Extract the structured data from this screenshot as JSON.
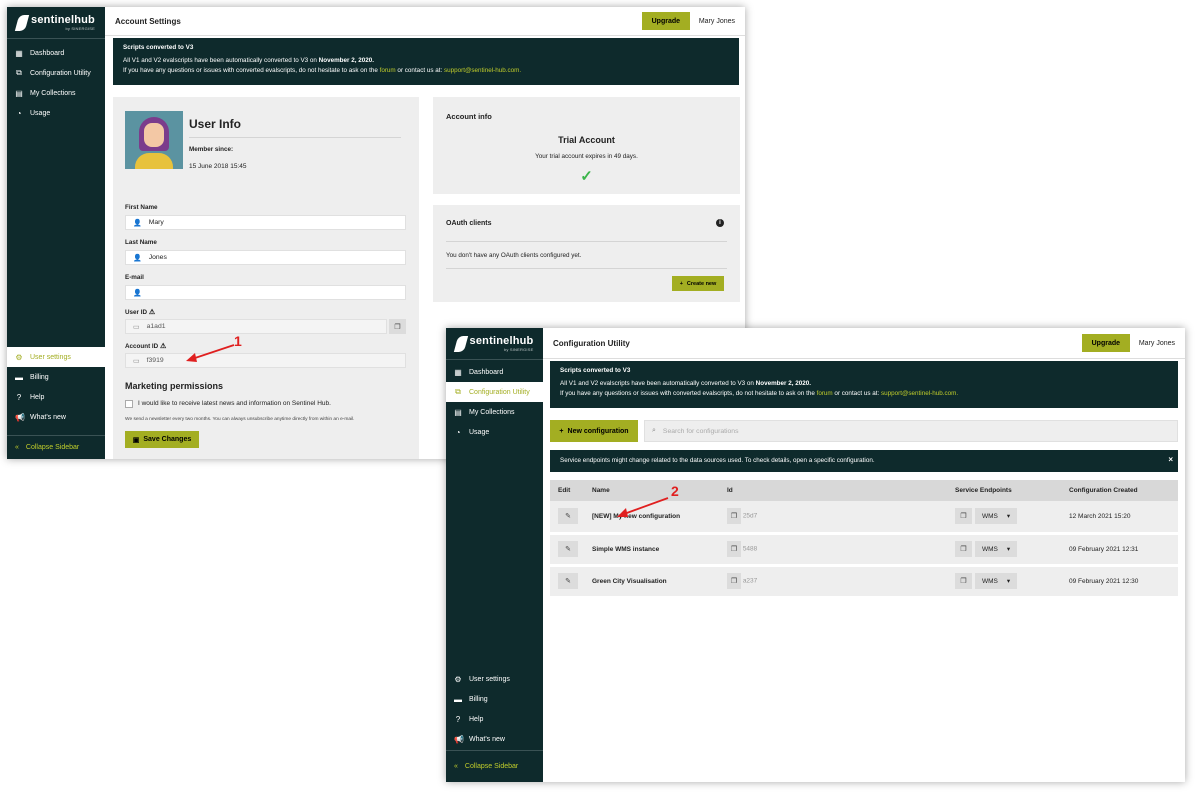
{
  "brand": {
    "name": "sentinelhub",
    "sub": "by SINERGISE"
  },
  "win1": {
    "title": "Account Settings",
    "upgrade": "Upgrade",
    "user": "Mary Jones",
    "notice": {
      "title": "Scripts converted to V3",
      "line1a": "All V1 and V2 evalscripts have been automatically converted to V3 on ",
      "line1b": "November 2, 2020.",
      "line2a": "If you have any questions or issues with converted evalscripts, do not hesitate to ask on the ",
      "forum": "forum",
      "line2b": " or contact us at: ",
      "email": "support@sentinel-hub.com."
    },
    "nav": [
      "Dashboard",
      "Configuration Utility",
      "My Collections",
      "Usage"
    ],
    "nav_bottom": [
      "User settings",
      "Billing",
      "Help",
      "What's new"
    ],
    "collapse": "Collapse Sidebar",
    "user_info": {
      "heading": "User Info",
      "member_since_label": "Member since:",
      "member_since": "15 June 2018 15:45",
      "first_name_label": "First Name",
      "first_name": "Mary",
      "last_name_label": "Last Name",
      "last_name": "Jones",
      "email_label": "E-mail",
      "email": "",
      "user_id_label": "User ID",
      "user_id": "a1ad1",
      "account_id_label": "Account ID",
      "account_id": "f3919",
      "marketing_heading": "Marketing permissions",
      "marketing_check": "I would like to receive latest news and information on Sentinel Hub.",
      "marketing_note": "We send a newsletter every two months. You can always unsubscribe anytime directly from within an e-mail.",
      "save": "Save Changes"
    },
    "account_info": {
      "heading": "Account info",
      "plan": "Trial Account",
      "expires": "Your trial account expires in 49 days."
    },
    "oauth": {
      "heading": "OAuth clients",
      "empty": "You don't have any OAuth clients configured yet.",
      "create": "Create new"
    }
  },
  "win2": {
    "title": "Configuration Utility",
    "upgrade": "Upgrade",
    "user": "Mary Jones",
    "notice": {
      "title": "Scripts converted to V3",
      "line1a": "All V1 and V2 evalscripts have been automatically converted to V3 on ",
      "line1b": "November 2, 2020.",
      "line2a": "If you have any questions or issues with converted evalscripts, do not hesitate to ask on the ",
      "forum": "forum",
      "line2b": " or contact us at: ",
      "email": "support@sentinel-hub.com."
    },
    "nav": [
      "Dashboard",
      "Configuration Utility",
      "My Collections",
      "Usage"
    ],
    "nav_bottom": [
      "User settings",
      "Billing",
      "Help",
      "What's new"
    ],
    "collapse": "Collapse Sidebar",
    "new_config": "New configuration",
    "search_placeholder": "Search for configurations",
    "endpoint_notice": "Service endpoints might change related to the data sources used. To check details, open a specific configuration.",
    "columns": [
      "Edit",
      "Name",
      "Id",
      "Service Endpoints",
      "Configuration Created"
    ],
    "rows": [
      {
        "name": "[NEW] My new configuration",
        "id": "25d7",
        "endpoint": "WMS",
        "created": "12 March 2021 15:20"
      },
      {
        "name": "Simple WMS instance",
        "id": "5488",
        "endpoint": "WMS",
        "created": "09 February 2021 12:31"
      },
      {
        "name": "Green City Visualisation",
        "id": "a237",
        "endpoint": "WMS",
        "created": "09 February 2021 12:30"
      }
    ]
  },
  "annotations": {
    "one": "1",
    "two": "2"
  },
  "colors": {
    "sidebar": "#0e2a2c",
    "accent": "#a3ae22",
    "annotation": "#e02020"
  }
}
